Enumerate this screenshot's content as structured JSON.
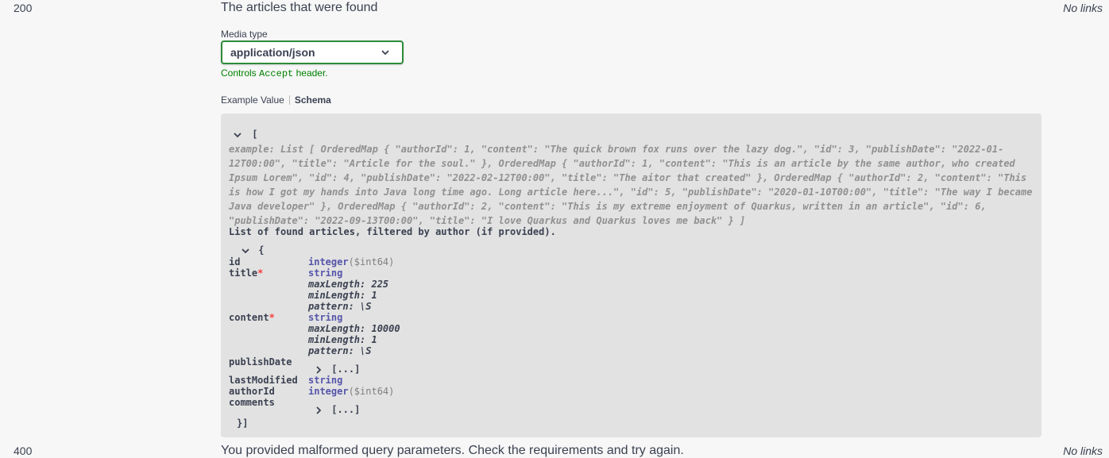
{
  "responses": [
    {
      "code": "200",
      "description": "The articles that were found",
      "links": "No links",
      "media_type_label": "Media type",
      "media_type_value": "application/json",
      "controls_prefix": "Controls",
      "controls_code": "Accept",
      "controls_suffix": "header.",
      "tabs": [
        "Example Value",
        "Schema"
      ],
      "active_tab": "Schema"
    },
    {
      "code": "400",
      "description": "You provided malformed query parameters. Check the requirements and try again.",
      "links": "No links"
    }
  ],
  "schema": {
    "open_array": "[",
    "example_lines": [
      "example: List [ OrderedMap { \"authorId\": 1, \"content\": \"The quick brown fox runs over the lazy dog.\", \"id\": 3, \"publishDate\": \"2022-01-",
      "12T00:00\", \"title\": \"Article for the soul.\" }, OrderedMap { \"authorId\": 1, \"content\": \"This is an article by the same author, who created",
      "Ipsum Lorem\", \"id\": 4, \"publishDate\": \"2022-02-12T00:00\", \"title\": \"The aitor that created\" }, OrderedMap { \"authorId\": 2, \"content\": \"This",
      "is how I got my hands into Java long time ago. Long article here...\", \"id\": 5, \"publishDate\": \"2020-01-10T00:00\", \"title\": \"The way I became",
      "Java developer\" }, OrderedMap { \"authorId\": 2, \"content\": \"This is my extreme enjoyment of Quarkus, written in an article\", \"id\": 6,",
      "\"publishDate\": \"2022-09-13T00:00\", \"title\": \"I love Quarkus and Quarkus loves me back\" } ]"
    ],
    "list_description": "List of found articles, filtered by author (if provided).",
    "open_object": "{",
    "close": "}]",
    "required_mark": "*",
    "collapsed": "[...]",
    "properties": {
      "id": {
        "name": "id",
        "type": "integer",
        "format": "($int64)"
      },
      "title": {
        "name": "title",
        "type": "string",
        "c1": "maxLength: 225",
        "c2": "minLength: 1",
        "c3": "pattern: \\S"
      },
      "content": {
        "name": "content",
        "type": "string",
        "c1": "maxLength: 10000",
        "c2": "minLength: 1",
        "c3": "pattern: \\S"
      },
      "publishDate": {
        "name": "publishDate"
      },
      "lastModified": {
        "name": "lastModified",
        "type": "string"
      },
      "authorId": {
        "name": "authorId",
        "type": "integer",
        "format": "($int64)"
      },
      "comments": {
        "name": "comments"
      }
    }
  },
  "colors": {
    "select_border": "#2e8b3a",
    "note_green": "#008000",
    "type_blue": "#5555aa",
    "required_red": "#f93e3e",
    "box_bg": "#e2e2e2"
  }
}
